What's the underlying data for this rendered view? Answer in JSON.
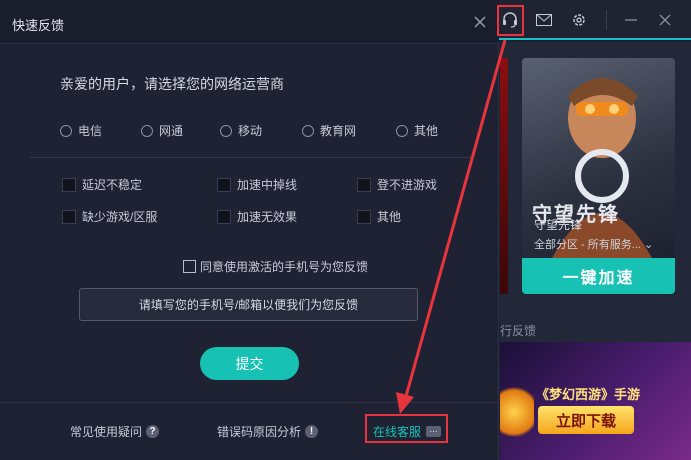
{
  "dialog": {
    "title": "快速反馈",
    "question": "亲爱的用户，请选择您的网络运营商",
    "carriers": [
      "电信",
      "网通",
      "移动",
      "教育网",
      "其他"
    ],
    "issues": [
      "延迟不稳定",
      "加速中掉线",
      "登不进游戏",
      "缺少游戏/区服",
      "加速无效果",
      "其他"
    ],
    "agree_label": "同意使用激活的手机号为您反馈",
    "contact_placeholder": "请填写您的手机号/邮箱以便我们为您反馈",
    "submit_label": "提交",
    "footer": {
      "faq": "常见使用疑问",
      "faq_icon": "?",
      "error_analysis": "错误码原因分析",
      "error_icon": "!",
      "online_service": "在线客服",
      "service_icon": "···"
    }
  },
  "background_app": {
    "game_card": {
      "art_title": "守望先锋",
      "name": "守望先锋",
      "region": "全部分区 - 所有服务...",
      "accelerate_button": "一键加速"
    },
    "feedback_peek": "行反馈",
    "banner": {
      "title": "《梦幻西游》手游",
      "download_button": "立即下载"
    }
  },
  "colors": {
    "accent": "#17c2b4",
    "annotation_red": "#e8343d",
    "dialog_bg": "#1f2233"
  },
  "icons": [
    "headset-icon",
    "mail-icon",
    "gear-icon",
    "minimize-icon",
    "close-icon"
  ]
}
